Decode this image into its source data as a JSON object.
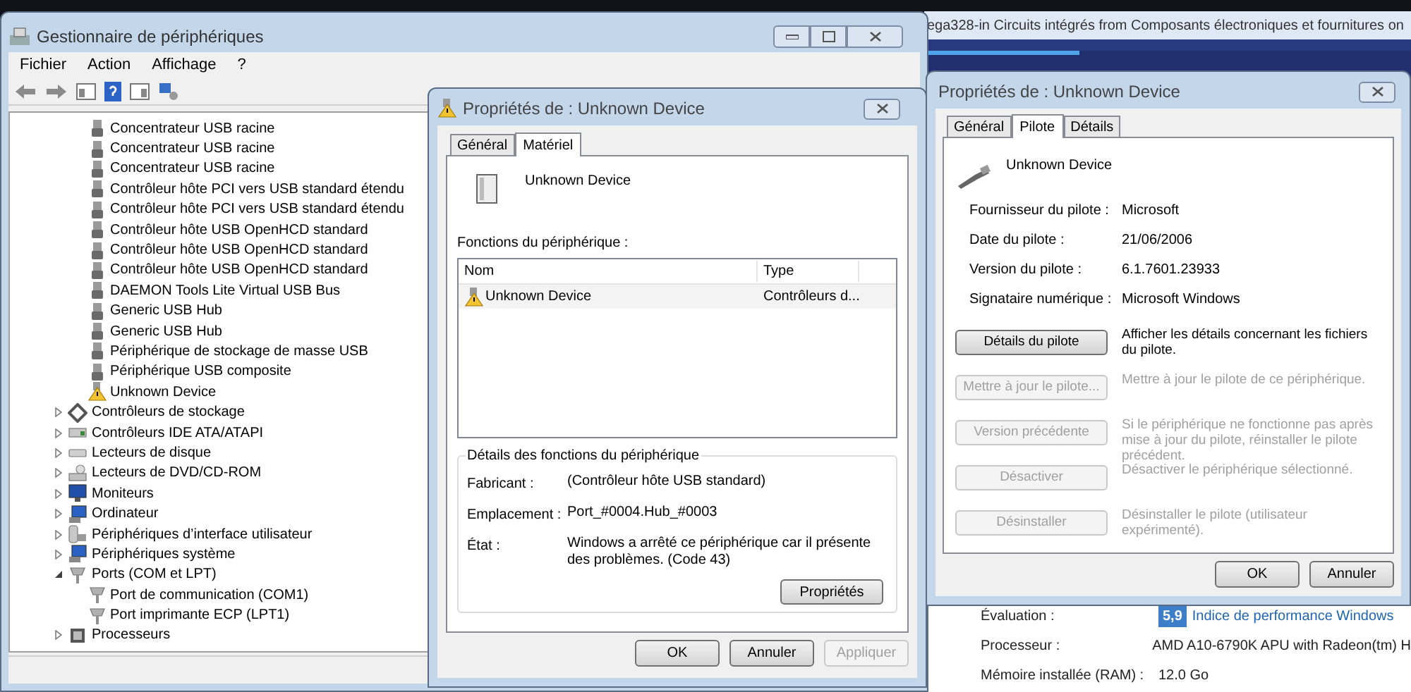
{
  "browser_window": {
    "title": "ega328-in Circuits intégrés from Composants électroniques et fournitures on",
    "rating": {
      "label": "Évaluation :",
      "badge": "5,9",
      "link": "Indice de performance Windows"
    },
    "specs": [
      {
        "label": "Processeur :",
        "value": "AMD A10-6790K APU with Radeon(tm) H"
      },
      {
        "label": "Mémoire installée (RAM) :",
        "value": "12.0 Go"
      }
    ]
  },
  "device_manager": {
    "title": "Gestionnaire de périphériques",
    "menu": [
      "Fichier",
      "Action",
      "Affichage",
      "?"
    ],
    "tree": {
      "scrolled_children": [
        {
          "label": "Concentrateur USB racine",
          "kind": "usb"
        },
        {
          "label": "Concentrateur USB racine",
          "kind": "usb"
        },
        {
          "label": "Concentrateur USB racine",
          "kind": "usb"
        },
        {
          "label": "Contrôleur hôte PCI vers USB standard étendu",
          "kind": "usb"
        },
        {
          "label": "Contrôleur hôte PCI vers USB standard étendu",
          "kind": "usb"
        },
        {
          "label": "Contrôleur hôte USB OpenHCD standard",
          "kind": "usb"
        },
        {
          "label": "Contrôleur hôte USB OpenHCD standard",
          "kind": "usb"
        },
        {
          "label": "Contrôleur hôte USB OpenHCD standard",
          "kind": "usb"
        },
        {
          "label": "DAEMON Tools Lite Virtual USB Bus",
          "kind": "usb"
        },
        {
          "label": "Generic USB Hub",
          "kind": "usb"
        },
        {
          "label": "Generic USB Hub",
          "kind": "usb"
        },
        {
          "label": "Périphérique de stockage de masse USB",
          "kind": "usb"
        },
        {
          "label": "Périphérique USB composite",
          "kind": "usb"
        },
        {
          "label": "Unknown Device",
          "kind": "warning"
        }
      ],
      "categories": [
        {
          "label": "Contrôleurs de stockage",
          "kind": "storage",
          "expanded": false
        },
        {
          "label": "Contrôleurs IDE ATA/ATAPI",
          "kind": "ide",
          "expanded": false
        },
        {
          "label": "Lecteurs de disque",
          "kind": "disk",
          "expanded": false
        },
        {
          "label": "Lecteurs de DVD/CD-ROM",
          "kind": "dvd",
          "expanded": false
        },
        {
          "label": "Moniteurs",
          "kind": "monitor",
          "expanded": false
        },
        {
          "label": "Ordinateur",
          "kind": "computer",
          "expanded": false
        },
        {
          "label": "Périphériques d’interface utilisateur",
          "kind": "hid",
          "expanded": false
        },
        {
          "label": "Périphériques système",
          "kind": "computer",
          "expanded": false
        },
        {
          "label": "Ports (COM et LPT)",
          "kind": "port",
          "expanded": true,
          "children": [
            {
              "label": "Port de communication (COM1)",
              "kind": "port"
            },
            {
              "label": "Port imprimante ECP (LPT1)",
              "kind": "port"
            }
          ]
        },
        {
          "label": "Processeurs",
          "kind": "cpu",
          "expanded": false
        }
      ]
    }
  },
  "hardware_dialog": {
    "title": "Propriétés de : Unknown Device",
    "tabs": [
      {
        "label": "Général",
        "selected": false
      },
      {
        "label": "Matériel",
        "selected": true
      }
    ],
    "device_name": "Unknown Device",
    "functions_label": "Fonctions du périphérique :",
    "columns": [
      "Nom",
      "Type"
    ],
    "rows": [
      {
        "name": "Unknown Device",
        "type": "Contrôleurs d...",
        "selected": false
      }
    ],
    "details_title": "Détails des fonctions du périphérique",
    "fields": [
      {
        "label": "Fabricant :",
        "value": "(Contrôleur hôte USB standard)"
      },
      {
        "label": "Emplacement :",
        "value": "Port_#0004.Hub_#0003"
      },
      {
        "label": "État :",
        "value": "Windows a arrêté ce périphérique car il présente des problèmes.  (Code 43)"
      }
    ],
    "properties_button": "Propriétés",
    "buttons": [
      {
        "label": "OK",
        "disabled": false
      },
      {
        "label": "Annuler",
        "disabled": false
      },
      {
        "label": "Appliquer",
        "disabled": true
      }
    ]
  },
  "driver_dialog": {
    "title": "Propriétés de : Unknown Device",
    "tabs": [
      {
        "label": "Général",
        "selected": false
      },
      {
        "label": "Pilote",
        "selected": true
      },
      {
        "label": "Détails",
        "selected": false
      }
    ],
    "device_name": "Unknown Device",
    "info": [
      {
        "label": "Fournisseur du pilote :",
        "value": "Microsoft"
      },
      {
        "label": "Date du pilote :",
        "value": "21/06/2006"
      },
      {
        "label": "Version du pilote :",
        "value": "6.1.7601.23933"
      },
      {
        "label": "Signataire numérique :",
        "value": "Microsoft Windows"
      }
    ],
    "actions": [
      {
        "button": "Détails du pilote",
        "description": "Afficher les détails concernant les fichiers du pilote.",
        "disabled": false
      },
      {
        "button": "Mettre à jour le pilote...",
        "description": "Mettre à jour le pilote de ce périphérique.",
        "disabled": true
      },
      {
        "button": "Version précédente",
        "description": "Si le périphérique ne fonctionne pas après mise à jour du pilote, réinstaller le pilote précédent.",
        "disabled": true
      },
      {
        "button": "Désactiver",
        "description": "Désactiver le périphérique sélectionné.",
        "disabled": true
      },
      {
        "button": "Désinstaller",
        "description": "Désinstaller le pilote (utilisateur expérimenté).",
        "disabled": true
      }
    ],
    "buttons": [
      {
        "label": "OK",
        "disabled": false
      },
      {
        "label": "Annuler",
        "disabled": false
      }
    ]
  }
}
